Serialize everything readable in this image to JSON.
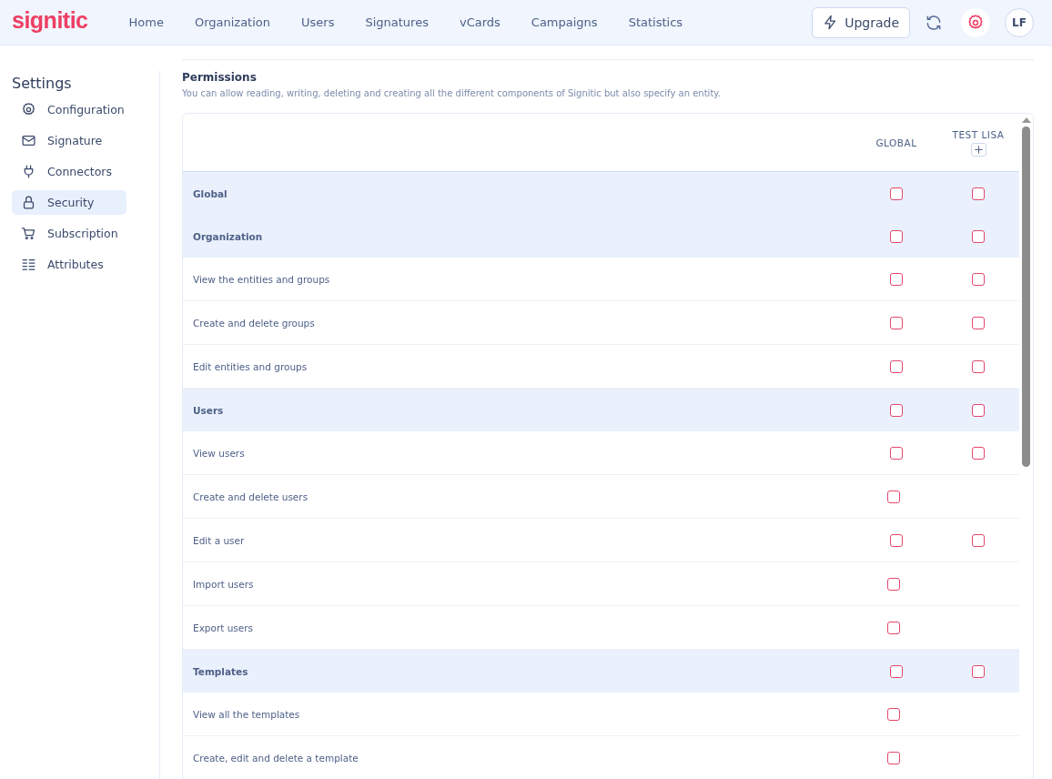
{
  "topbar": {
    "logo": "signitic",
    "nav": [
      {
        "label": "Home",
        "selected": false
      },
      {
        "label": "Organization",
        "selected": false
      },
      {
        "label": "Users",
        "selected": false
      },
      {
        "label": "Signatures",
        "selected": false
      },
      {
        "label": "vCards",
        "selected": false
      },
      {
        "label": "Campaigns",
        "selected": false
      },
      {
        "label": "Statistics",
        "selected": false
      }
    ],
    "upgrade": "Upgrade",
    "settings_active": true,
    "avatar": "LF"
  },
  "sidebar": {
    "title": "Settings",
    "items": [
      {
        "label": "Configuration",
        "selected": false
      },
      {
        "label": "Signature",
        "selected": false
      },
      {
        "label": "Connectors",
        "selected": false
      },
      {
        "label": "Security",
        "selected": true
      },
      {
        "label": "Subscription",
        "selected": false
      },
      {
        "label": "Attributes",
        "selected": false
      }
    ]
  },
  "permissions": {
    "title": "Permissions",
    "description": "You can allow reading, writing, deleting and creating all the different components of Signitic but also specify an entity.",
    "columns": [
      {
        "label": "GLOBAL",
        "add": false
      },
      {
        "label": "TEST LISA",
        "add": true
      }
    ],
    "rows": [
      {
        "kind": "section",
        "label": "Global",
        "checks": [
          {
            "checked": false
          },
          {
            "checked": false
          }
        ]
      },
      {
        "kind": "section",
        "label": "Organization",
        "checks": [
          {
            "checked": false
          },
          {
            "checked": false
          }
        ]
      },
      {
        "kind": "item",
        "label": "View the entities and groups",
        "checks": [
          {
            "checked": false
          },
          {
            "checked": false
          }
        ]
      },
      {
        "kind": "item",
        "label": "Create and delete groups",
        "checks": [
          {
            "checked": false
          },
          {
            "checked": false
          }
        ]
      },
      {
        "kind": "item",
        "label": "Edit entities and groups",
        "checks": [
          {
            "checked": false
          },
          {
            "checked": false
          }
        ]
      },
      {
        "kind": "section",
        "label": "Users",
        "checks": [
          {
            "checked": false
          },
          {
            "checked": false
          }
        ]
      },
      {
        "kind": "item",
        "label": "View users",
        "checks": [
          {
            "checked": false
          },
          {
            "checked": false
          }
        ]
      },
      {
        "kind": "item",
        "label": "Create and delete users",
        "checks": [
          {
            "checked": false
          }
        ]
      },
      {
        "kind": "item",
        "label": "Edit a user",
        "checks": [
          {
            "checked": false
          },
          {
            "checked": false
          }
        ]
      },
      {
        "kind": "item",
        "label": "Import users",
        "checks": [
          {
            "checked": false
          }
        ]
      },
      {
        "kind": "item",
        "label": "Export users",
        "checks": [
          {
            "checked": false
          }
        ]
      },
      {
        "kind": "section",
        "label": "Templates",
        "checks": [
          {
            "checked": false
          },
          {
            "checked": false
          }
        ]
      },
      {
        "kind": "item",
        "label": "View all the templates",
        "checks": [
          {
            "checked": false
          }
        ]
      },
      {
        "kind": "item",
        "label": "Create, edit and delete a template",
        "checks": [
          {
            "checked": false
          }
        ]
      }
    ]
  }
}
